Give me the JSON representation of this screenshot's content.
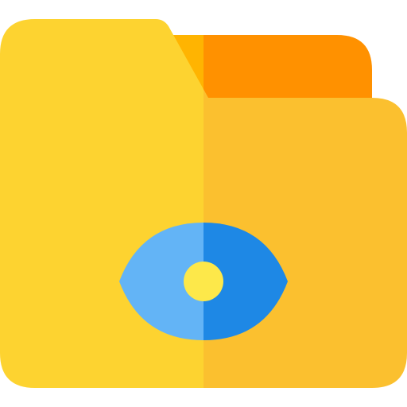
{
  "icon": {
    "name": "folder-eye-icon",
    "colors": {
      "back_tab_left": "#FFB401",
      "back_tab_right": "#FF9100",
      "front_left": "#FDD330",
      "front_right": "#FBC02F",
      "eye_left": "#63B4F6",
      "eye_right": "#1E88E5",
      "pupil": "#FDE84A"
    }
  }
}
